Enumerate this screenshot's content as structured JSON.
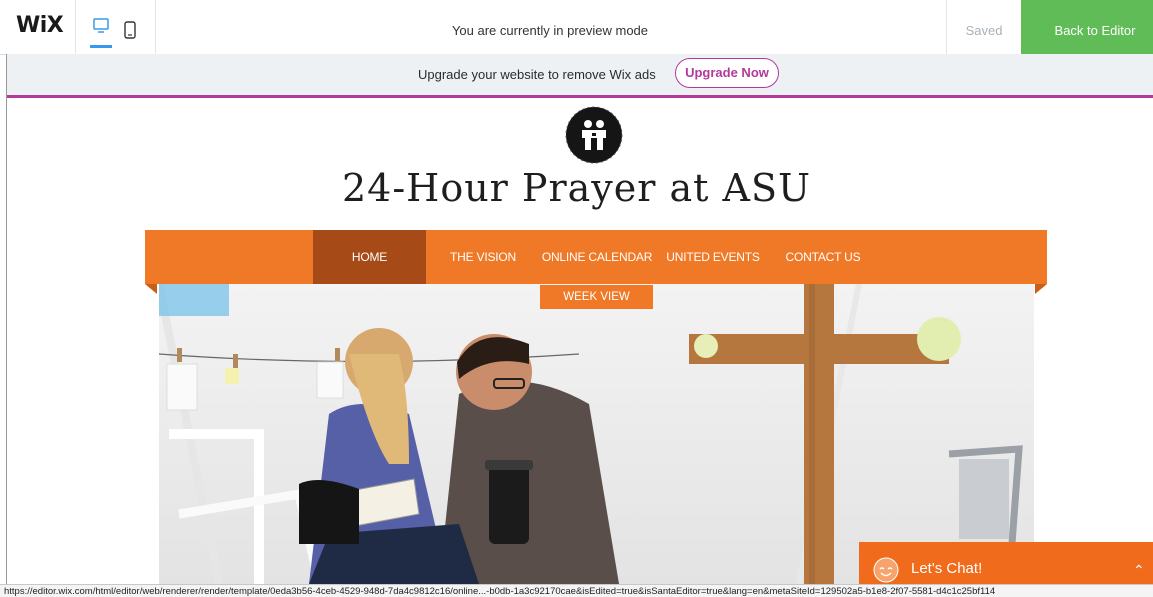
{
  "topbar": {
    "logo_text": "WiX",
    "desktop_view_icon": "desktop-icon",
    "mobile_view_icon": "mobile-icon",
    "preview_message": "You are currently in preview mode",
    "saved_label": "Saved",
    "back_button_label": "Back to Editor",
    "accent_color": "#60bc57"
  },
  "upgrade_banner": {
    "message": "Upgrade your website to remove Wix ads",
    "button_label": "Upgrade Now",
    "accent_color": "#b3399a"
  },
  "site": {
    "logo_icon": "two-people-logo-icon",
    "title": "24-Hour Prayer at ASU",
    "nav": {
      "color": "#f07928",
      "active_color": "#a64a18",
      "items": [
        {
          "label": "HOME",
          "active": true
        },
        {
          "label": "THE VISION",
          "active": false
        },
        {
          "label": "ONLINE CALENDAR",
          "active": false
        },
        {
          "label": "UNITED EVENTS",
          "active": false
        },
        {
          "label": "CONTACT US",
          "active": false
        }
      ],
      "submenu": {
        "label": "WEEK VIEW"
      }
    },
    "hero_image": "photo-of-two-people-praying-with-bible-near-wooden-cross"
  },
  "chat_widget": {
    "label": "Let's Chat!",
    "icon": "smiley-chat-icon",
    "caret_icon": "chevron-up-icon",
    "color": "#f06b1b"
  },
  "status_bar": {
    "url": "https://editor.wix.com/html/editor/web/renderer/render/template/0eda3b56-4ceb-4529-948d-7da4c9812c16/online...-b0db-1a3c92170cae&isEdited=true&isSantaEditor=true&lang=en&metaSiteId=129502a5-b1e8-2f07-5581-d4c1c25bf114"
  }
}
